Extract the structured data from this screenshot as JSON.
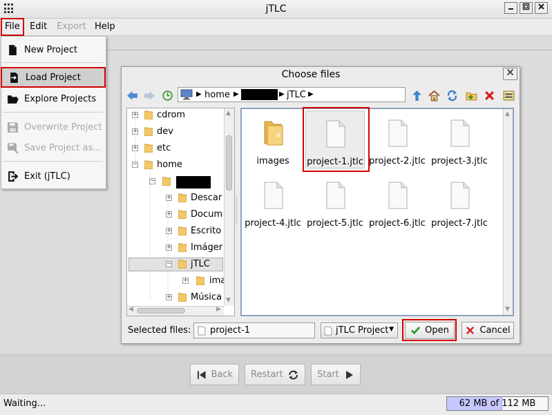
{
  "window": {
    "title": "jTLC"
  },
  "menubar": {
    "items": [
      {
        "label": "File",
        "enabled": true
      },
      {
        "label": "Edit",
        "enabled": true
      },
      {
        "label": "Export",
        "enabled": false
      },
      {
        "label": "Help",
        "enabled": true
      }
    ]
  },
  "file_menu": {
    "items": [
      {
        "label": "New Project",
        "icon": "document-icon",
        "enabled": true
      },
      {
        "label": "Load Project",
        "icon": "load-document-icon",
        "enabled": true,
        "highlighted": true
      },
      {
        "label": "Explore Projects",
        "icon": "folder-open-icon",
        "enabled": true
      },
      {
        "label": "Overwrite Project",
        "icon": "save-icon",
        "enabled": false
      },
      {
        "label": "Save Project as...",
        "icon": "save-as-icon",
        "enabled": false
      },
      {
        "label": "Exit (jTLC)",
        "icon": "exit-icon",
        "enabled": true
      }
    ]
  },
  "dialog": {
    "title": "Choose files",
    "close_label": "✕",
    "path": {
      "segments": [
        "home",
        "jTLC"
      ]
    },
    "tree": {
      "nodes": [
        {
          "label": "cdrom"
        },
        {
          "label": "dev"
        },
        {
          "label": "etc"
        },
        {
          "label": "home"
        },
        {
          "label": "Descar"
        },
        {
          "label": "Docum"
        },
        {
          "label": "Escrito"
        },
        {
          "label": "Imáger"
        },
        {
          "label": "jTLC"
        },
        {
          "label": "ima"
        },
        {
          "label": "Música"
        }
      ]
    },
    "files": [
      {
        "label": "images",
        "type": "folder"
      },
      {
        "label": "project-1.jtlc",
        "type": "file",
        "selected": true
      },
      {
        "label": "project-2.jtlc",
        "type": "file"
      },
      {
        "label": "project-3.jtlc",
        "type": "file"
      },
      {
        "label": "project-4.jtlc",
        "type": "file"
      },
      {
        "label": "project-5.jtlc",
        "type": "file"
      },
      {
        "label": "project-6.jtlc",
        "type": "file"
      },
      {
        "label": "project-7.jtlc",
        "type": "file"
      }
    ],
    "selected_files_label": "Selected files:",
    "selected_files_value": "project-1",
    "filter_value": "jTLC Project",
    "open_label": "Open",
    "cancel_label": "Cancel"
  },
  "wizard": {
    "back_label": "Back",
    "restart_label": "Restart",
    "start_label": "Start"
  },
  "status": {
    "text": "Waiting...",
    "memory_text": "62 MB of 112 MB",
    "memory_used_fraction": 0.55
  },
  "colors": {
    "highlight_red": "#d40000",
    "memory_fill": "#c7c7ff",
    "selection_border": "#8ea2c0"
  }
}
